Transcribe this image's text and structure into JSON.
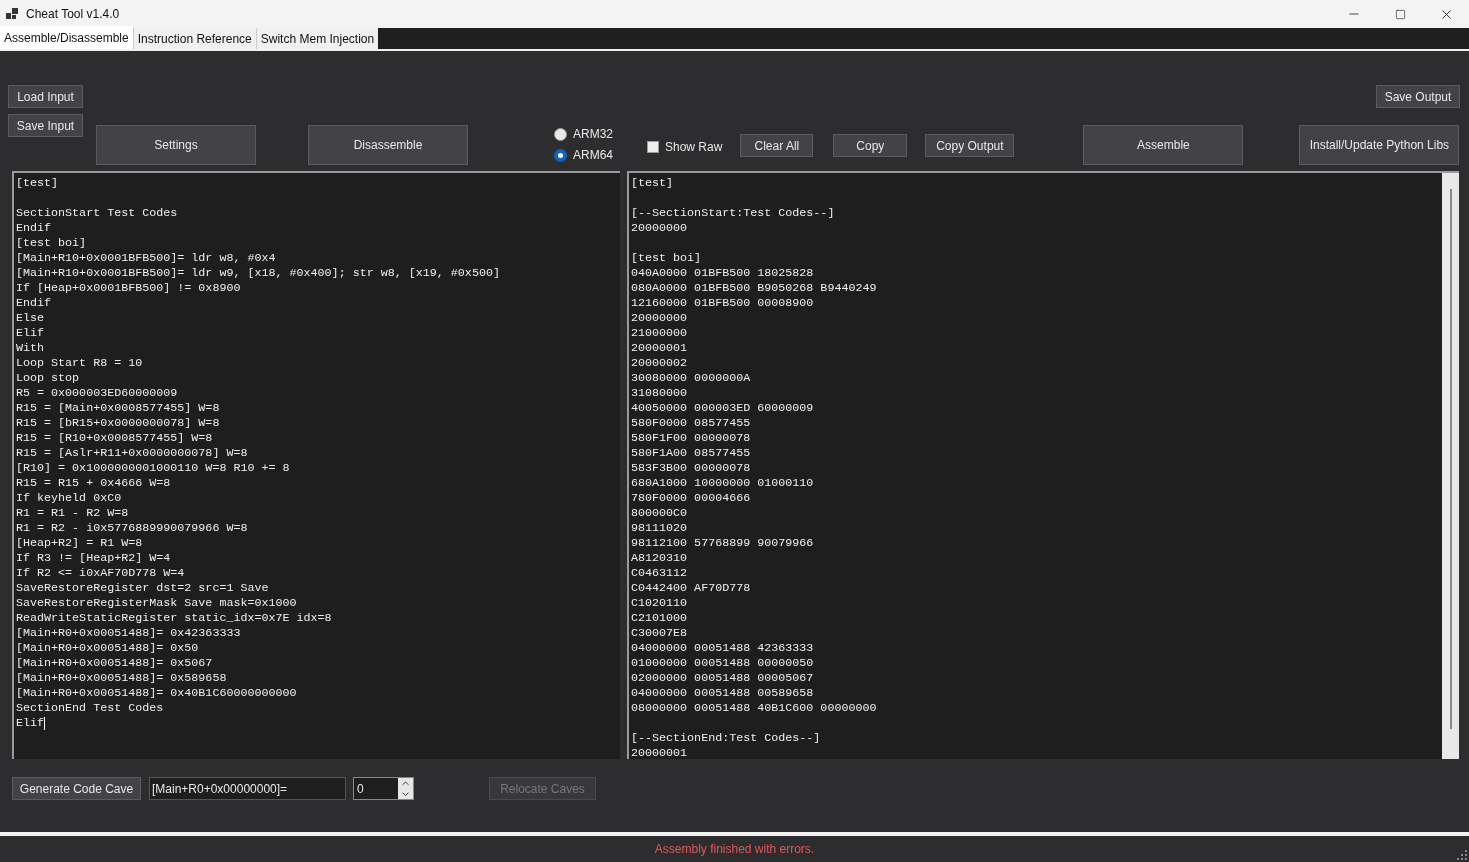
{
  "window": {
    "title": "Cheat Tool v1.4.0"
  },
  "tabs": [
    {
      "label": "Assemble/Disassemble",
      "selected": true
    },
    {
      "label": "Instruction Reference",
      "selected": false
    },
    {
      "label": "Switch Mem Injection",
      "selected": false
    }
  ],
  "toolbar": {
    "load_input": "Load Input",
    "save_output": "Save Output",
    "save_input": "Save Input",
    "settings": "Settings",
    "disassemble": "Disassemble",
    "architectures": [
      {
        "label": "ARM32",
        "selected": false
      },
      {
        "label": "ARM64",
        "selected": true
      }
    ],
    "show_raw": {
      "label": "Show Raw",
      "checked": false
    },
    "clear_all": "Clear All",
    "copy": "Copy",
    "copy_output": "Copy Output",
    "assemble": "Assemble",
    "install": "Install/Update Python Libs"
  },
  "input_editor": {
    "blocks": [
      [
        "[test]"
      ],
      [
        "SectionStart Test Codes",
        "Endif",
        "[test boi]",
        "[Main+R10+0x0001BFB500]= ldr w8, #0x4",
        "[Main+R10+0x0001BFB500]= ldr w9, [x18, #0x400]; str w8, [x19, #0x500]",
        "If [Heap+0x0001BFB500] != 0x8900",
        "Endif",
        "Else",
        "Elif",
        "With",
        "Loop Start R8 = 10",
        "Loop stop",
        "R5 = 0x000003ED60000009",
        "R15 = [Main+0x0008577455] W=8",
        "R15 = [bR15+0x0000000078] W=8",
        "R15 = [R10+0x0008577455] W=8",
        "R15 = [Aslr+R11+0x0000000078] W=8",
        "[R10] = 0x1000000001000110 W=8 R10 += 8",
        "R15 = R15 + 0x4666 W=8",
        "If keyheld 0xC0",
        "R1 = R1 - R2 W=8",
        "R1 = R2 - i0x5776889990079966 W=8",
        "[Heap+R2] = R1 W=8",
        "If R3 != [Heap+R2] W=4",
        "If R2 <= i0xAF70D778 W=4",
        "SaveRestoreRegister dst=2 src=1 Save",
        "SaveRestoreRegisterMask Save mask=0x1000",
        "ReadWriteStaticRegister static_idx=0x7E idx=8",
        "[Main+R0+0x00051488]= 0x42363333",
        "[Main+R0+0x00051488]= 0x50",
        "[Main+R0+0x00051488]= 0x5067",
        "[Main+R0+0x00051488]= 0x589658",
        "[Main+R0+0x00051488]= 0x40B1C60000000000",
        "SectionEnd Test Codes",
        "Elif"
      ]
    ],
    "caret": true
  },
  "output_editor": {
    "blocks": [
      [
        "[test]"
      ],
      [
        "[--SectionStart:Test Codes--]",
        "20000000"
      ],
      [
        "[test boi]",
        "040A0000 01BFB500 18025828",
        "080A0000 01BFB500 B9050268 B9440249",
        "12160000 01BFB500 00008900",
        "20000000",
        "21000000",
        "20000001",
        "20000002",
        "30080000 0000000A",
        "31080000",
        "40050000 000003ED 60000009",
        "580F0000 08577455",
        "580F1F00 00000078",
        "580F1A00 08577455",
        "583F3B00 00000078",
        "680A1000 10000000 01000110",
        "780F0000 00004666",
        "800000C0",
        "98111020",
        "98112100 57768899 90079966",
        "A8120310",
        "C0463112",
        "C0442400 AF70D778",
        "C1020110",
        "C2101000",
        "C30007E8",
        "04000000 00051488 42363333",
        "01000000 00051488 00000050",
        "02000000 00051488 00005067",
        "04000000 00051488 00589658",
        "08000000 00051488 40B1C600 00000000"
      ],
      [
        "[--SectionEnd:Test Codes--]",
        "20000001"
      ]
    ]
  },
  "code_cave": {
    "button": "Generate Code Cave",
    "value": "[Main+R0+0x00000000]=",
    "count": "0",
    "relocate": {
      "label": "Relocate Caves",
      "disabled": true
    }
  },
  "status_bar": {
    "text": "Assembly finished with errors.",
    "kind": "error"
  }
}
